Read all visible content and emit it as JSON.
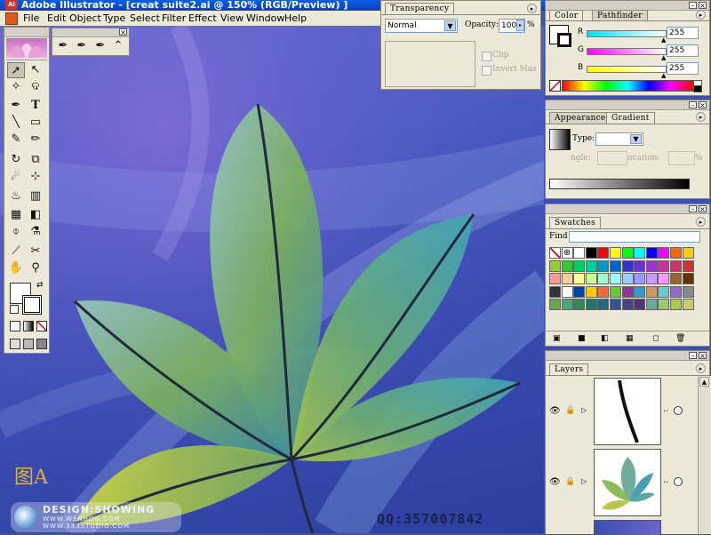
{
  "window": {
    "title": "Adobe Illustrator - [creat suite2.ai @ 150% (RGB/Preview) ]",
    "app_icon": "Ai"
  },
  "menu": [
    "File",
    "Edit",
    "Object",
    "Type",
    "Select",
    "Filter",
    "Effect",
    "View",
    "Window",
    "Help"
  ],
  "transparency": {
    "tab": "Transparency",
    "blend_mode": "Normal",
    "opacity_label": "Opacity:",
    "opacity_value": "100",
    "opacity_unit": "%",
    "clip_label": "Clip",
    "invert_mask_label": "Invert Mas"
  },
  "color_panel": {
    "tabs": [
      "Color",
      "Pathfinder"
    ],
    "channels": [
      {
        "label": "R",
        "value": "255",
        "color": "#00e0ff"
      },
      {
        "label": "G",
        "value": "255",
        "color": "#ff00ff"
      },
      {
        "label": "B",
        "value": "255",
        "color": "#ffff00"
      }
    ]
  },
  "gradient_panel": {
    "tabs": [
      "Appearance",
      "Gradient"
    ],
    "type_label": "Type:",
    "angle_label": "ngle:",
    "location_label": "ocation:",
    "location_unit": "%"
  },
  "swatches_panel": {
    "tab": "Swatches",
    "find_label": "Find"
  },
  "layers_panel": {
    "tab": "Layers",
    "rows": [
      {
        "dots": ".."
      },
      {
        "dots": ".."
      }
    ]
  },
  "artwork": {
    "figure_label": "图A",
    "brand_line1": "DESIGN:SHOWING",
    "brand_line2": "WWW.WENHOO.COM",
    "brand_line3": "WWW.3X3STUDIO.COM",
    "qq": "QQ:357007842"
  },
  "colors": {
    "title_bar": "#0a4fd8",
    "leaf_green": "#8fbf3a",
    "leaf_teal": "#3b9ba6",
    "canvas_blue": "#3c50b0",
    "figure_label": "#d6b04a"
  }
}
